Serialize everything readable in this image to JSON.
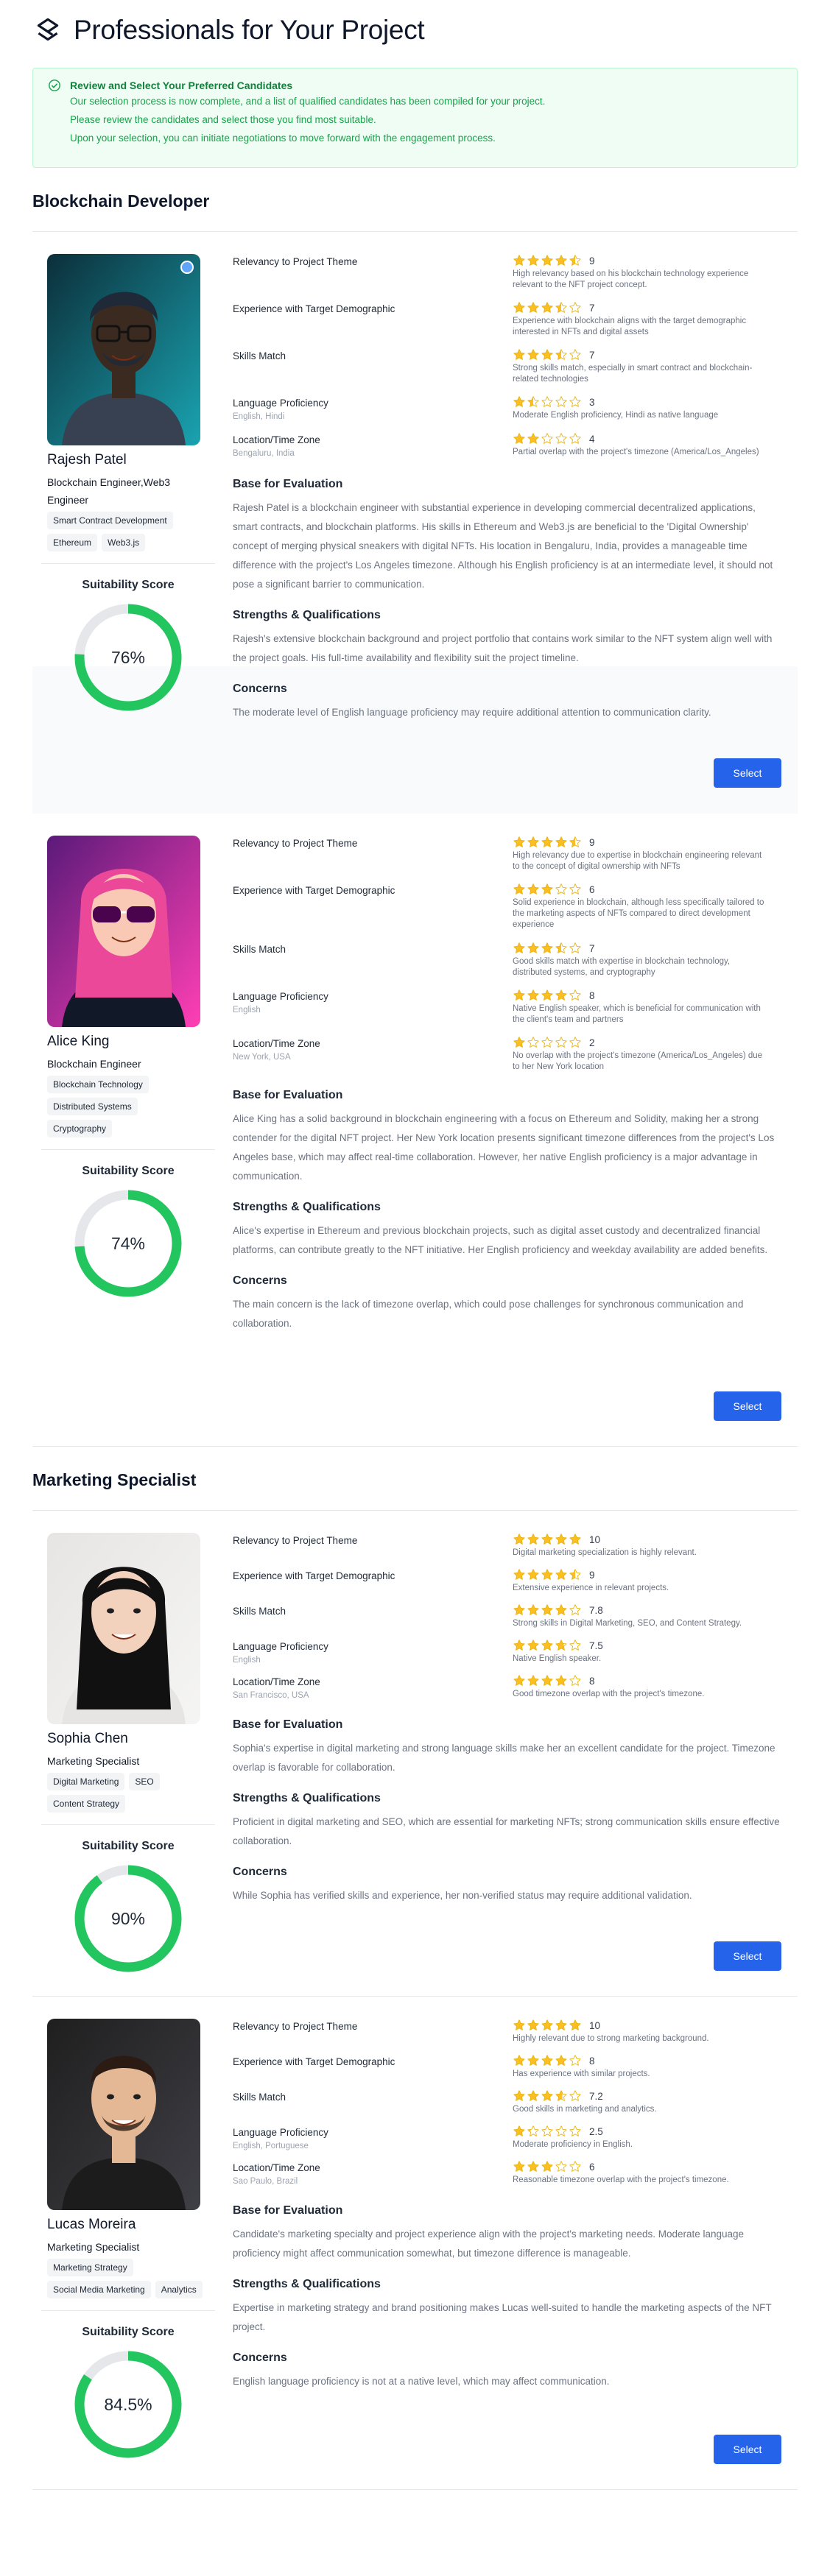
{
  "page": {
    "title": "Professionals for Your Project"
  },
  "notice": {
    "heading": "Review and Select Your Preferred Candidates",
    "lines": [
      "Our selection process is now complete, and a list of qualified candidates has been compiled for your project.",
      "Please review the candidates and select those you find most suitable.",
      "Upon your selection, you can initiate negotiations to move forward with the engagement process."
    ]
  },
  "labels": {
    "relevancy": "Relevancy to Project Theme",
    "experience": "Experience with Target Demographic",
    "skills": "Skills Match",
    "language": "Language Proficiency",
    "location": "Location/Time Zone",
    "base": "Base for Evaluation",
    "strengths": "Strengths & Qualifications",
    "concerns": "Concerns",
    "score": "Suitability Score",
    "select": "Select"
  },
  "colors": {
    "accent": "#2563eb",
    "score": "#22c55e",
    "star": "#fbbf24",
    "notice_text": "#16a34a"
  },
  "sections": [
    {
      "title": "Blockchain Developer",
      "candidates": [
        {
          "name": "Rajesh Patel",
          "role": "Blockchain Engineer,Web3 Engineer",
          "tags": [
            "Smart Contract Development",
            "Ethereum",
            "Web3.js"
          ],
          "score": "76%",
          "score_value": 76,
          "relevancy": {
            "rating": 9,
            "note": "High relevancy based on his blockchain technology experience relevant to the NFT project concept."
          },
          "experience": {
            "rating": 7,
            "note": "Experience with blockchain aligns with the target demographic interested in NFTs and digital assets"
          },
          "skills": {
            "rating": 7,
            "note": "Strong skills match, especially in smart contract and blockchain-related technologies"
          },
          "language": {
            "rating": 3,
            "sub": "English, Hindi",
            "note": "Moderate English proficiency, Hindi as native language"
          },
          "location": {
            "rating": 4,
            "sub": "Bengaluru, India",
            "note": "Partial overlap with the project's timezone (America/Los_Angeles)"
          },
          "base": "Rajesh Patel is a blockchain engineer with substantial experience in developing commercial decentralized applications, smart contracts, and blockchain platforms. His skills in Ethereum and Web3.js are beneficial to the 'Digital Ownership' concept of merging physical sneakers with digital NFTs. His location in Bengaluru, India, provides a manageable time difference with the project's Los Angeles timezone. Although his English proficiency is at an intermediate level, it should not pose a significant barrier to communication.",
          "strengths": "Rajesh's extensive blockchain background and project portfolio that contains work similar to the NFT system align well with the project goals. His full-time availability and flexibility suit the project timeline.",
          "concerns": "The moderate level of English language proficiency may require additional attention to communication clarity."
        },
        {
          "name": "Alice King",
          "role": "Blockchain Engineer",
          "tags": [
            "Blockchain Technology",
            "Distributed Systems",
            "Cryptography"
          ],
          "score": "74%",
          "score_value": 74,
          "relevancy": {
            "rating": 9,
            "note": "High relevancy due to expertise in blockchain engineering relevant to the concept of digital ownership with NFTs"
          },
          "experience": {
            "rating": 6,
            "note": "Solid experience in blockchain, although less specifically tailored to the marketing aspects of NFTs compared to direct development experience"
          },
          "skills": {
            "rating": 7,
            "note": "Good skills match with expertise in blockchain technology, distributed systems, and cryptography"
          },
          "language": {
            "rating": 8,
            "sub": "English",
            "note": "Native English speaker, which is beneficial for communication with the client's team and partners"
          },
          "location": {
            "rating": 2,
            "sub": "New York, USA",
            "note": "No overlap with the project's timezone (America/Los_Angeles) due to her New York location"
          },
          "base": "Alice King has a solid background in blockchain engineering with a focus on Ethereum and Solidity, making her a strong contender for the digital NFT project. Her New York location presents significant timezone differences from the project's Los Angeles base, which may affect real-time collaboration. However, her native English proficiency is a major advantage in communication.",
          "strengths": "Alice's expertise in Ethereum and previous blockchain projects, such as digital asset custody and decentralized financial platforms, can contribute greatly to the NFT initiative. Her English proficiency and weekday availability are added benefits.",
          "concerns": "The main concern is the lack of timezone overlap, which could pose challenges for synchronous communication and collaboration."
        }
      ]
    },
    {
      "title": "Marketing Specialist",
      "candidates": [
        {
          "name": "Sophia Chen",
          "role": "Marketing Specialist",
          "tags": [
            "Digital Marketing",
            "SEO",
            "Content Strategy"
          ],
          "score": "90%",
          "score_value": 90,
          "relevancy": {
            "rating": 10,
            "note": "Digital marketing specialization is highly relevant."
          },
          "experience": {
            "rating": 9,
            "note": "Extensive experience in relevant projects."
          },
          "skills": {
            "rating": 7.8,
            "note": "Strong skills in Digital Marketing, SEO, and Content Strategy."
          },
          "language": {
            "rating": 7.5,
            "sub": "English",
            "note": "Native English speaker."
          },
          "location": {
            "rating": 8,
            "sub": "San Francisco, USA",
            "note": "Good timezone overlap with the project's timezone."
          },
          "base": "Sophia's expertise in digital marketing and strong language skills make her an excellent candidate for the project. Timezone overlap is favorable for collaboration.",
          "strengths": "Proficient in digital marketing and SEO, which are essential for marketing NFTs; strong communication skills ensure effective collaboration.",
          "concerns": "While Sophia has verified skills and experience, her non-verified status may require additional validation."
        },
        {
          "name": "Lucas Moreira",
          "role": "Marketing Specialist",
          "tags": [
            "Marketing Strategy",
            "Social Media Marketing",
            "Analytics"
          ],
          "score": "84.5%",
          "score_value": 84.5,
          "relevancy": {
            "rating": 10,
            "note": "Highly relevant due to strong marketing background."
          },
          "experience": {
            "rating": 8,
            "note": "Has experience with similar projects."
          },
          "skills": {
            "rating": 7.2,
            "note": "Good skills in marketing and analytics."
          },
          "language": {
            "rating": 2.5,
            "sub": "English, Portuguese",
            "note": "Moderate proficiency in English."
          },
          "location": {
            "rating": 6,
            "sub": "Sao Paulo, Brazil",
            "note": "Reasonable timezone overlap with the project's timezone."
          },
          "base": "Candidate's marketing specialty and project experience align with the project's marketing needs. Moderate language proficiency might affect communication somewhat, but timezone difference is manageable.",
          "strengths": "Expertise in marketing strategy and brand positioning makes Lucas well-suited to handle the marketing aspects of the NFT project.",
          "concerns": "English language proficiency is not at a native level, which may affect communication."
        }
      ]
    }
  ]
}
